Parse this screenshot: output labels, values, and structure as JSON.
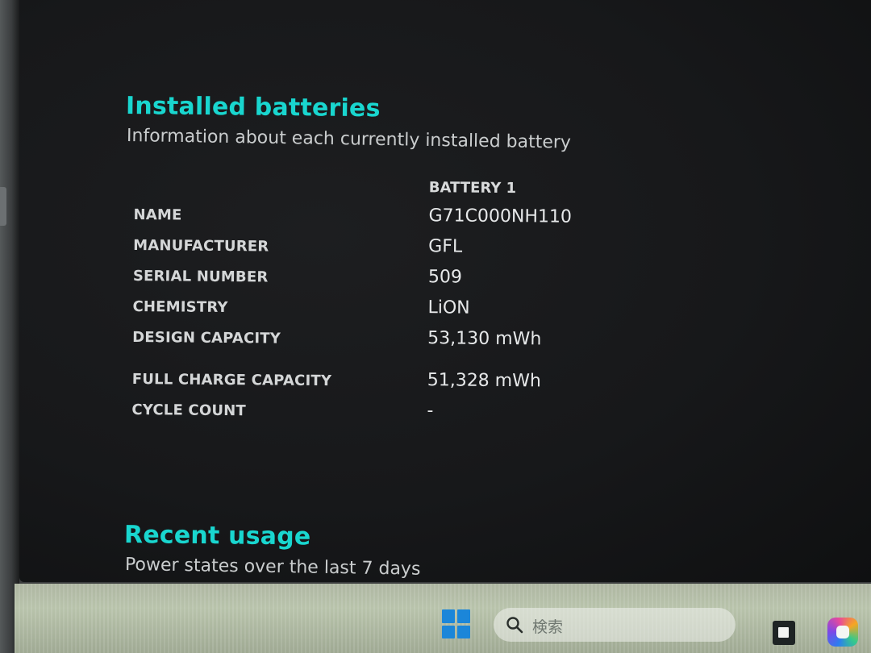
{
  "installed_batteries": {
    "title": "Installed batteries",
    "subtitle": "Information about each currently installed battery",
    "column_header": "BATTERY 1",
    "rows": [
      {
        "label": "NAME",
        "value": "G71C000NH110"
      },
      {
        "label": "MANUFACTURER",
        "value": "GFL"
      },
      {
        "label": "SERIAL NUMBER",
        "value": "509"
      },
      {
        "label": "CHEMISTRY",
        "value": "LiON"
      },
      {
        "label": "DESIGN CAPACITY",
        "value": "53,130 mWh"
      },
      {
        "label": "FULL CHARGE CAPACITY",
        "value": "51,328 mWh"
      },
      {
        "label": "CYCLE COUNT",
        "value": "-"
      }
    ]
  },
  "recent_usage": {
    "title": "Recent usage",
    "subtitle": "Power states over the last 7 days"
  },
  "taskbar": {
    "start_icon": "windows-logo-icon",
    "search_placeholder": "検索",
    "search_icon": "search-icon",
    "pinned_apps": [
      "app-icon",
      "copilot-icon"
    ]
  },
  "colors": {
    "heading": "#19d6cf",
    "text": "#e6e8e9",
    "background": "#17181a",
    "start_icon": "#1b86d9"
  }
}
